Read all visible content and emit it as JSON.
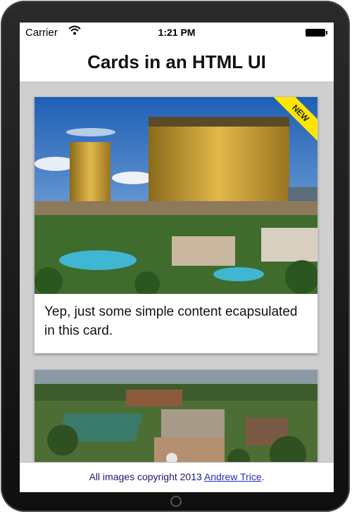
{
  "status_bar": {
    "carrier": "Carrier",
    "time": "1:21 PM"
  },
  "header": {
    "title": "Cards in an HTML UI"
  },
  "cards": [
    {
      "badge": "NEW",
      "text": "Yep, just some simple content ecapsulated in this card.",
      "image": "las-vegas-hotel-photo"
    },
    {
      "image": "campus-aerial-photo"
    }
  ],
  "footer": {
    "prefix": "All images copyright 2013 ",
    "link": "Andrew Trice",
    "suffix": "."
  },
  "colors": {
    "ribbon": "#ffe600",
    "link": "#2030c0",
    "background": "#cfcfcf"
  }
}
